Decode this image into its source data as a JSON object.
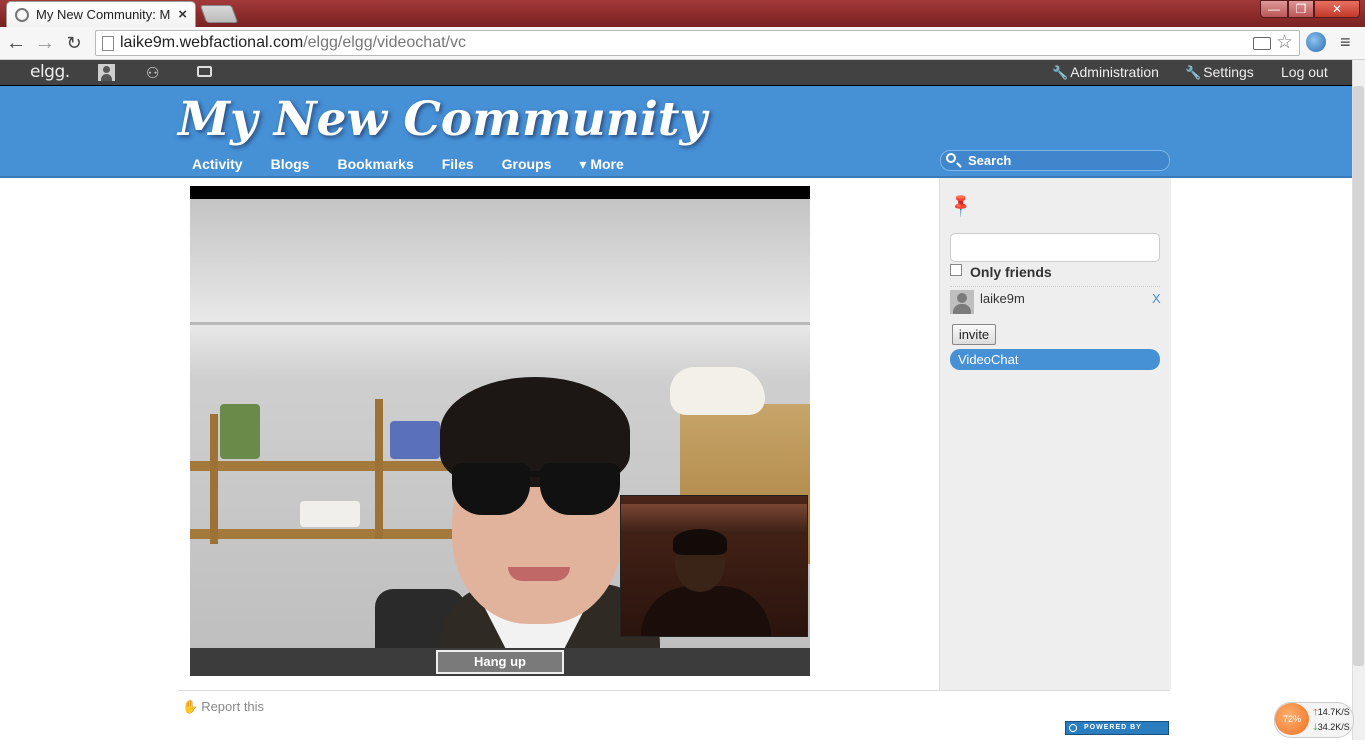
{
  "browser": {
    "tab_title": "My New Community: M",
    "tab_close": "×",
    "url_host": "laike9m.webfactional.com",
    "url_path": "/elgg/elgg/videochat/vc",
    "window_min": "—",
    "window_max": "❐",
    "window_close": "✕",
    "back": "←",
    "forward": "→",
    "reload": "↻",
    "menu": "≡",
    "star": "☆"
  },
  "topbar": {
    "logo": "elgg.",
    "friends_icon_glyph": "⚇",
    "admin_label": "Administration",
    "settings_label": "Settings",
    "logout_label": "Log out"
  },
  "header": {
    "site_name": "My New Community",
    "menu": [
      "Activity",
      "Blogs",
      "Bookmarks",
      "Files",
      "Groups",
      "▾ More"
    ],
    "search_placeholder": "Search"
  },
  "video": {
    "hangup_label": "Hang up"
  },
  "sidebar": {
    "pin_glyph": "📌",
    "filter_value": "",
    "only_friends_label": "Only friends",
    "only_friends_checked": false,
    "users": [
      {
        "name": "laike9m",
        "remove": "X"
      }
    ],
    "invite_label": "invite",
    "selected_item": "VideoChat"
  },
  "footer": {
    "report_label": "Report this",
    "powered_badge": "POWERED BY ELGG"
  },
  "net_widget": {
    "percent": "72%",
    "up": "14.7K/S",
    "down": "34.2K/S"
  },
  "colors": {
    "header_blue": "#4690d6",
    "topbar_dark": "#424242",
    "accent": "#4690d6"
  }
}
